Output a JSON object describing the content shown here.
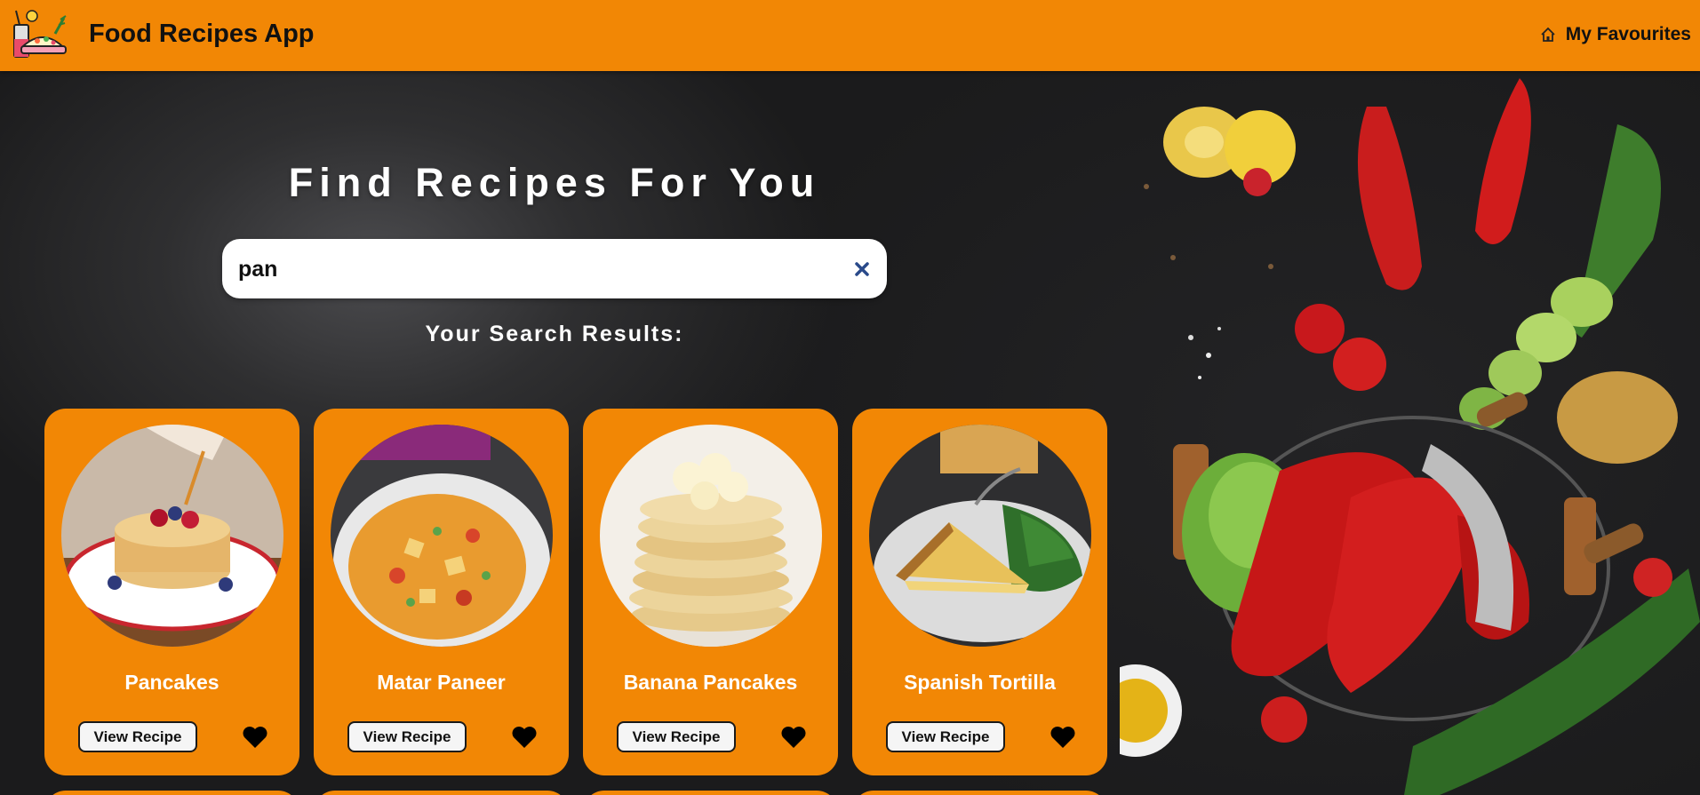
{
  "header": {
    "app_title": "Food Recipes App",
    "favourites_label": "My Favourites"
  },
  "hero": {
    "title": "Find Recipes For You"
  },
  "search": {
    "value": "pan",
    "results_label": "Your Search Results:"
  },
  "cards": [
    {
      "name": "Pancakes",
      "button": "View Recipe"
    },
    {
      "name": "Matar Paneer",
      "button": "View Recipe"
    },
    {
      "name": "Banana Pancakes",
      "button": "View Recipe"
    },
    {
      "name": "Spanish Tortilla",
      "button": "View Recipe"
    }
  ],
  "colors": {
    "accent": "#f28705",
    "background": "#2c2c2e",
    "text_light": "#ffffff",
    "text_dark": "#111111"
  },
  "icons": [
    "logo-icon",
    "home-icon",
    "clear-icon",
    "heart-icon"
  ]
}
